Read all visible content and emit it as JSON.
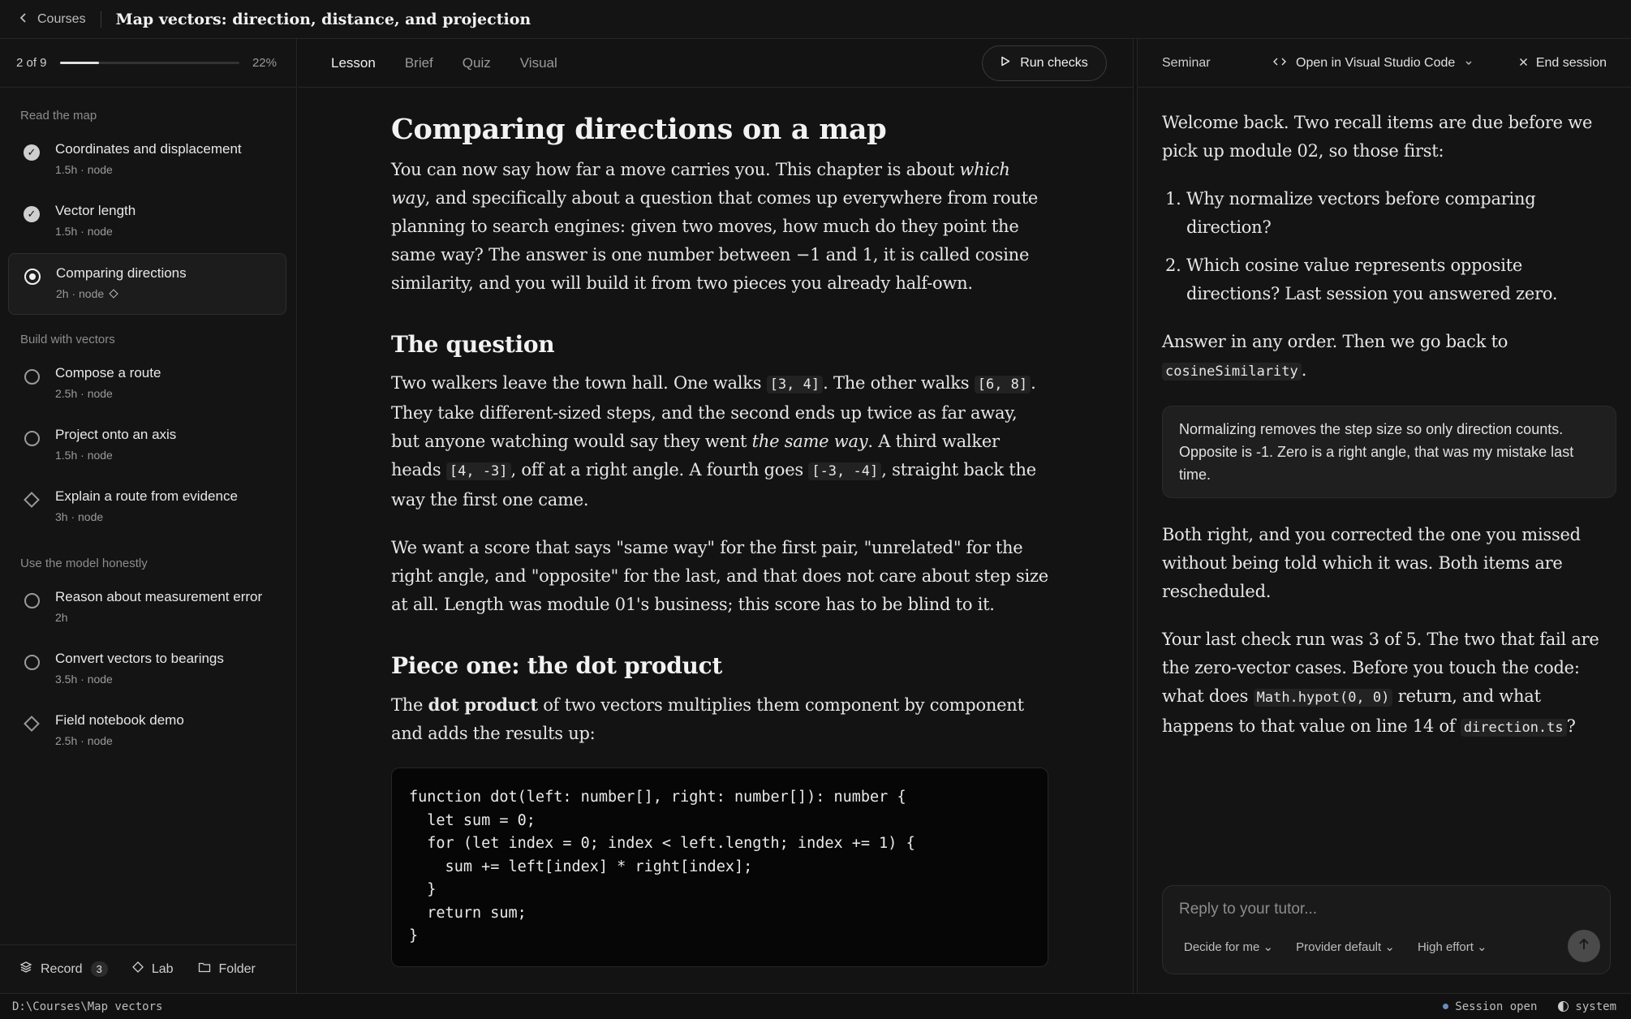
{
  "topbar": {
    "back_label": "Courses",
    "title": "Map vectors: direction, distance, and projection"
  },
  "sidebar": {
    "progress_label": "2 of 9",
    "progress_percent": 22,
    "progress_text": "22%",
    "sections": [
      {
        "label": "Read the map",
        "items": [
          {
            "title": "Coordinates and displacement",
            "meta": "1.5h · node",
            "status": "done"
          },
          {
            "title": "Vector length",
            "meta": "1.5h · node",
            "status": "done"
          },
          {
            "title": "Comparing directions",
            "meta": "2h · node",
            "status": "current"
          }
        ]
      },
      {
        "label": "Build with vectors",
        "items": [
          {
            "title": "Compose a route",
            "meta": "2.5h · node",
            "status": "open"
          },
          {
            "title": "Project onto an axis",
            "meta": "1.5h · node",
            "status": "open"
          },
          {
            "title": "Explain a route from evidence",
            "meta": "3h · node",
            "status": "milestone"
          }
        ]
      },
      {
        "label": "Use the model honestly",
        "items": [
          {
            "title": "Reason about measurement error",
            "meta": "2h",
            "status": "open"
          },
          {
            "title": "Convert vectors to bearings",
            "meta": "3.5h · node",
            "status": "open"
          },
          {
            "title": "Field notebook demo",
            "meta": "2.5h · node",
            "status": "milestone"
          }
        ]
      }
    ],
    "footer": {
      "record_label": "Record",
      "record_count": "3",
      "lab_label": "Lab",
      "folder_label": "Folder"
    }
  },
  "center": {
    "tabs": [
      "Lesson",
      "Brief",
      "Quiz",
      "Visual"
    ],
    "active_tab": "Lesson",
    "run_checks_label": "Run checks",
    "article": {
      "h1": "Comparing directions on a map",
      "intro_1": "You can now say how far a move carries you. This chapter is about ",
      "intro_em": "which way",
      "intro_2": ", and specifically about a question that comes up everywhere from route planning to search engines: given two moves, how much do they point the same way? The answer is one number between −1 and 1, it is called cosine similarity, and you will build it from two pieces you already half-own.",
      "h2_question": "The question",
      "q_p1": "Two walkers leave the town hall. One walks ",
      "q_code1": "[3, 4]",
      "q_p2": ". The other walks ",
      "q_code2": "[6, 8]",
      "q_p3": ". They take different-sized steps, and the second ends up twice as far away, but anyone watching would say they went ",
      "q_em": "the same way",
      "q_p4": ". A third walker heads ",
      "q_code3": "[4, -3]",
      "q_p5": ", off at a right angle. A fourth goes ",
      "q_code4": "[-3, -4]",
      "q_p6": ", straight back the way the first one came.",
      "q_para2": "We want a score that says \"same way\" for the first pair, \"unrelated\" for the right angle, and \"opposite\" for the last, and that does not care about step size at all. Length was module 01's business; this score has to be blind to it.",
      "h2_dot": "Piece one: the dot product",
      "dot_p1": "The ",
      "dot_strong": "dot product",
      "dot_p2": " of two vectors multiplies them component by component and adds the results up:",
      "code": "function dot(left: number[], right: number[]): number {\n  let sum = 0;\n  for (let index = 0; index < left.length; index += 1) {\n    sum += left[index] * right[index];\n  }\n  return sum;\n}"
    }
  },
  "seminar": {
    "label": "Seminar",
    "open_vs_label": "Open in Visual Studio Code",
    "end_session_label": "End session",
    "msg1": "Welcome back. Two recall items are due before we pick up module 02, so those first:",
    "list": [
      "Why normalize vectors before comparing direction?",
      "Which cosine value represents opposite directions? Last session you answered zero."
    ],
    "msg2_pre": "Answer in any order. Then we go back to ",
    "msg2_code": "cosineSimilarity",
    "msg2_post": ".",
    "student_reply": "Normalizing removes the step size so only direction counts. Opposite is -1. Zero is a right angle, that was my mistake last time.",
    "msg3": "Both right, and you corrected the one you missed without being told which it was. Both items are rescheduled.",
    "msg4_a": "Your last check run was 3 of 5. The two that fail are the zero-vector cases. Before you touch the code: what does ",
    "msg4_code1": "Math.hypot(0, 0)",
    "msg4_b": " return, and what happens to that value on line 14 of ",
    "msg4_code2": "direction.ts",
    "msg4_c": "?",
    "composer": {
      "placeholder": "Reply to your tutor...",
      "opt1": "Decide for me",
      "opt2": "Provider default",
      "opt3": "High effort"
    }
  },
  "statusbar": {
    "path": "D:\\Courses\\Map vectors",
    "session": "Session open",
    "theme": "system"
  },
  "colors": {
    "background": "#111112",
    "panel": "#141414",
    "border": "#262626",
    "text": "#e6e6e6",
    "muted": "#9a9a9a"
  }
}
